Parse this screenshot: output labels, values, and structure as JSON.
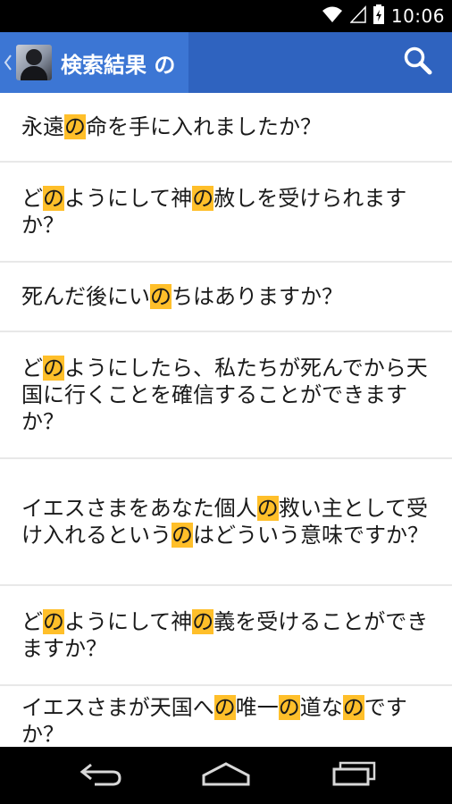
{
  "status_bar": {
    "time": "10:06",
    "icons": [
      "wifi-icon",
      "signal-icon",
      "battery-icon"
    ]
  },
  "action_bar": {
    "title": "検索結果 の",
    "icons": [
      "up-chevron-icon",
      "app-avatar-icon",
      "search-icon"
    ]
  },
  "results": [
    {
      "segments": [
        {
          "t": "永遠",
          "h": false
        },
        {
          "t": "の",
          "h": true
        },
        {
          "t": "命を手に入れましたか？",
          "h": false
        }
      ]
    },
    {
      "segments": [
        {
          "t": "ど",
          "h": false
        },
        {
          "t": "の",
          "h": true
        },
        {
          "t": "ようにして神",
          "h": false
        },
        {
          "t": "の",
          "h": true
        },
        {
          "t": "赦しを受けられますか？",
          "h": false
        }
      ]
    },
    {
      "segments": [
        {
          "t": "死んだ後にい",
          "h": false
        },
        {
          "t": "の",
          "h": true
        },
        {
          "t": "ちはありますか？",
          "h": false
        }
      ]
    },
    {
      "segments": [
        {
          "t": "ど",
          "h": false
        },
        {
          "t": "の",
          "h": true
        },
        {
          "t": "ようにしたら、私たちが死んでから天国に行くことを確信することができますか？",
          "h": false
        }
      ]
    },
    {
      "segments": [
        {
          "t": "イエスさまをあなた個人",
          "h": false
        },
        {
          "t": "の",
          "h": true
        },
        {
          "t": "救い主として受け入れるという",
          "h": false
        },
        {
          "t": "の",
          "h": true
        },
        {
          "t": "はどういう意味ですか？",
          "h": false
        }
      ]
    },
    {
      "segments": [
        {
          "t": "ど",
          "h": false
        },
        {
          "t": "の",
          "h": true
        },
        {
          "t": "ようにして神",
          "h": false
        },
        {
          "t": "の",
          "h": true
        },
        {
          "t": "義を受けることができますか？",
          "h": false
        }
      ]
    },
    {
      "segments": [
        {
          "t": "イエスさまが天国へ",
          "h": false
        },
        {
          "t": "の",
          "h": true
        },
        {
          "t": "唯一",
          "h": false
        },
        {
          "t": "の",
          "h": true
        },
        {
          "t": "道な",
          "h": false
        },
        {
          "t": "の",
          "h": true
        },
        {
          "t": "ですか？",
          "h": false
        }
      ]
    }
  ],
  "colors": {
    "action_bar": "#2f63bf",
    "action_bar_up": "#3c76d4",
    "highlight": "#ffbf2a"
  },
  "nav_bar": {
    "icons": [
      "back-icon",
      "home-icon",
      "recents-icon"
    ]
  }
}
